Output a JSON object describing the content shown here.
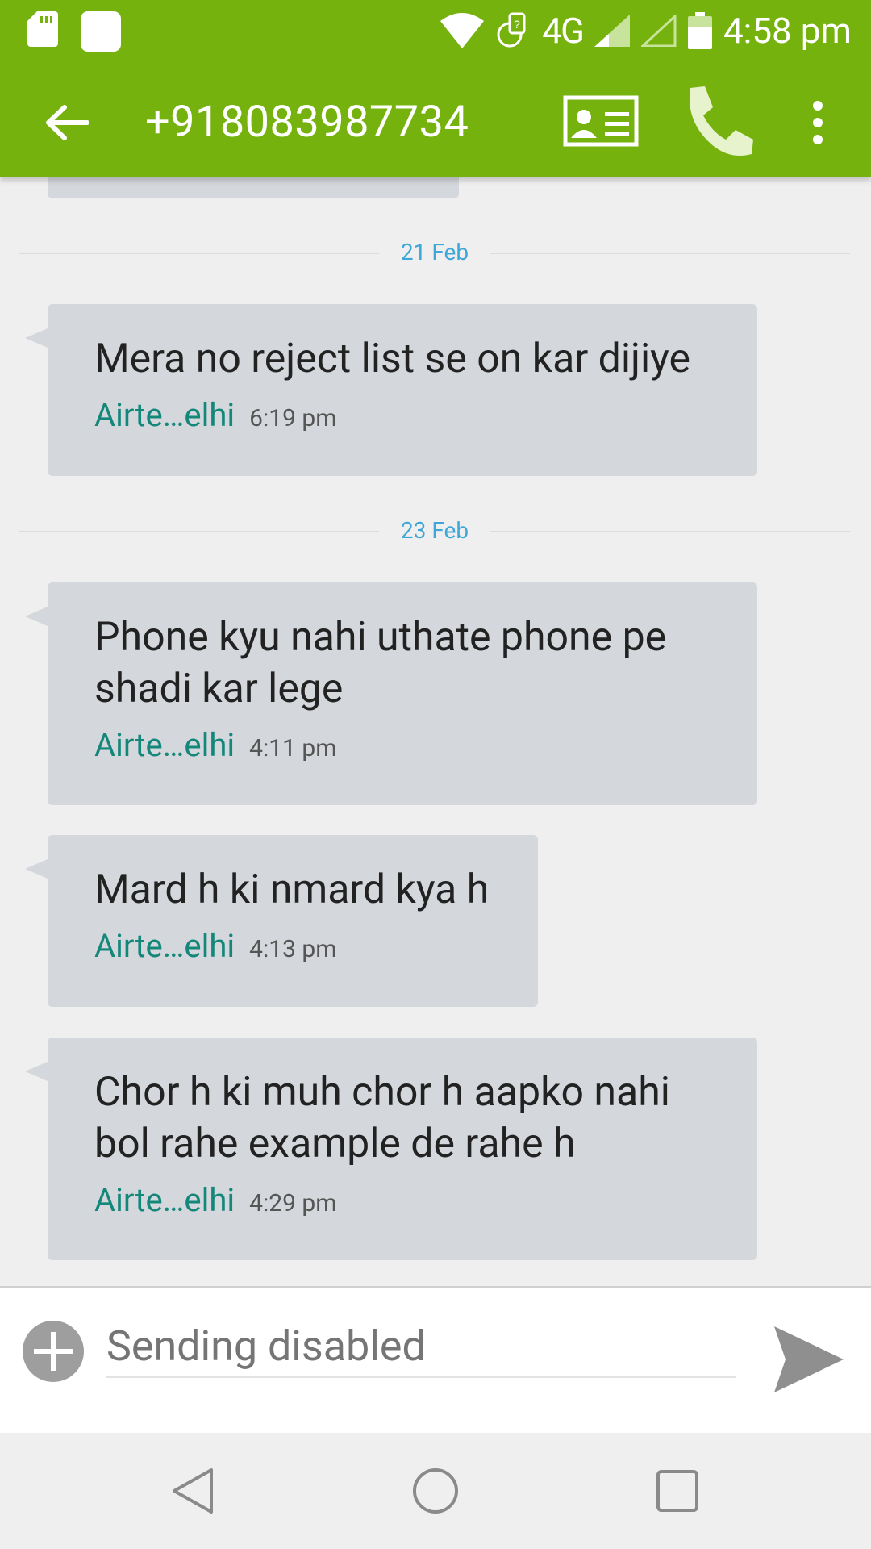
{
  "status_bar": {
    "time": "4:58 pm",
    "network": "4G"
  },
  "header": {
    "title": "+918083987734"
  },
  "conversation": {
    "separators": [
      {
        "label": "21 Feb"
      },
      {
        "label": "23 Feb"
      }
    ],
    "messages": [
      {
        "text": "Mera no reject list se on kar dijiye",
        "sender": "Airte…elhi",
        "time": "6:19 pm"
      },
      {
        "text": "Phone kyu nahi uthate phone pe shadi kar lege",
        "sender": "Airte…elhi",
        "time": "4:11 pm"
      },
      {
        "text": "Mard h ki nmard kya h",
        "sender": "Airte…elhi",
        "time": "4:13 pm"
      },
      {
        "text": "Chor h ki muh chor h aapko nahi bol rahe example de rahe h",
        "sender": "Airte…elhi",
        "time": "4:29 pm"
      }
    ]
  },
  "compose": {
    "placeholder": "Sending disabled"
  },
  "colors": {
    "toolbar": "#76b20e",
    "bubble": "#d4d7db",
    "sender": "#13877a",
    "date_label": "#3fa7d8"
  },
  "icons": [
    "sd-card-icon",
    "notification-icon",
    "wifi-icon",
    "data-icon",
    "signal-icon",
    "battery-icon",
    "back-arrow-icon",
    "contact-card-icon",
    "phone-icon",
    "more-vert-icon",
    "add-icon",
    "send-icon",
    "nav-back-icon",
    "nav-home-icon",
    "nav-recents-icon"
  ]
}
